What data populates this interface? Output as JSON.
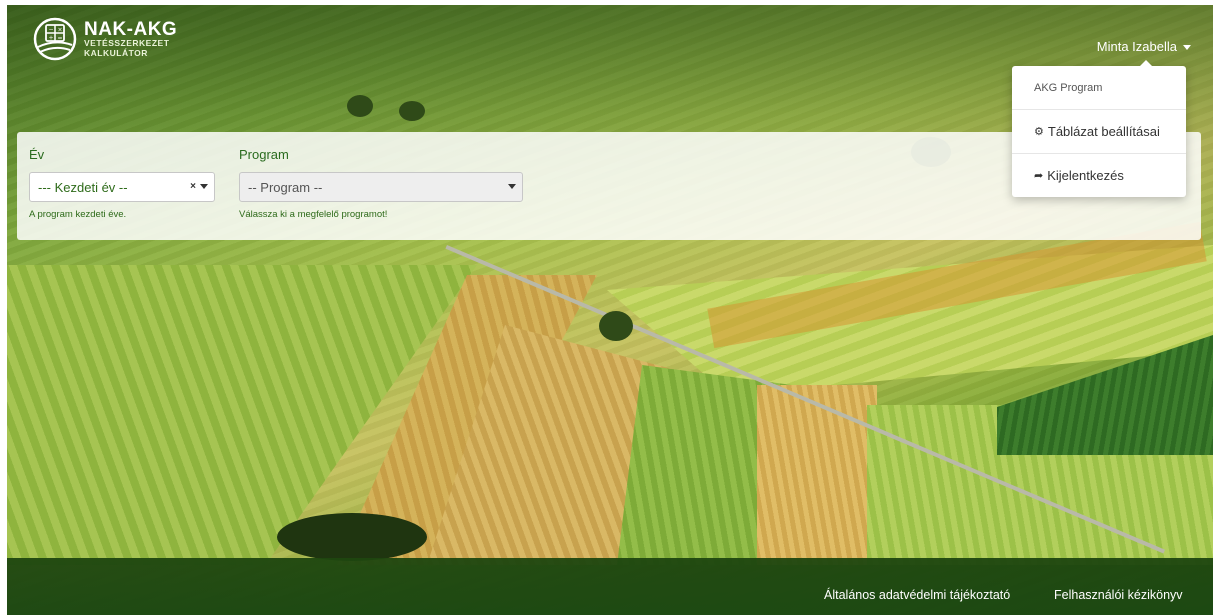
{
  "brand": {
    "name": "NAK-AKG",
    "subtitle_line1": "VETÉSSZERKEZET",
    "subtitle_line2": "KALKULÁTOR",
    "icon": "calculator-field-logo-icon",
    "color": "#3e7c2a"
  },
  "user_menu": {
    "name": "Minta Izabella",
    "icon": "chevron-down-icon"
  },
  "dropdown": {
    "header": "AKG Program",
    "items": [
      {
        "label": "Táblázat beállításai",
        "icon": "gears-icon"
      },
      {
        "label": "Kijelentkezés",
        "icon": "sign-out-icon"
      }
    ]
  },
  "filters": {
    "year": {
      "label": "Év",
      "value": "--- Kezdeti év --",
      "clear_glyph": "×",
      "help": "A program kezdeti éve."
    },
    "program": {
      "label": "Program",
      "value": "-- Program --",
      "help": "Válassza ki a megfelelő programot!"
    }
  },
  "footer": {
    "links": [
      {
        "label": "Általános adatvédelmi tájékoztató"
      },
      {
        "label": "Felhasználói kézikönyv"
      }
    ]
  },
  "colors": {
    "accent_green": "#2e6b1a",
    "footer_bg": "#1e4a12",
    "panel_bg": "rgba(255,255,255,0.85)"
  }
}
